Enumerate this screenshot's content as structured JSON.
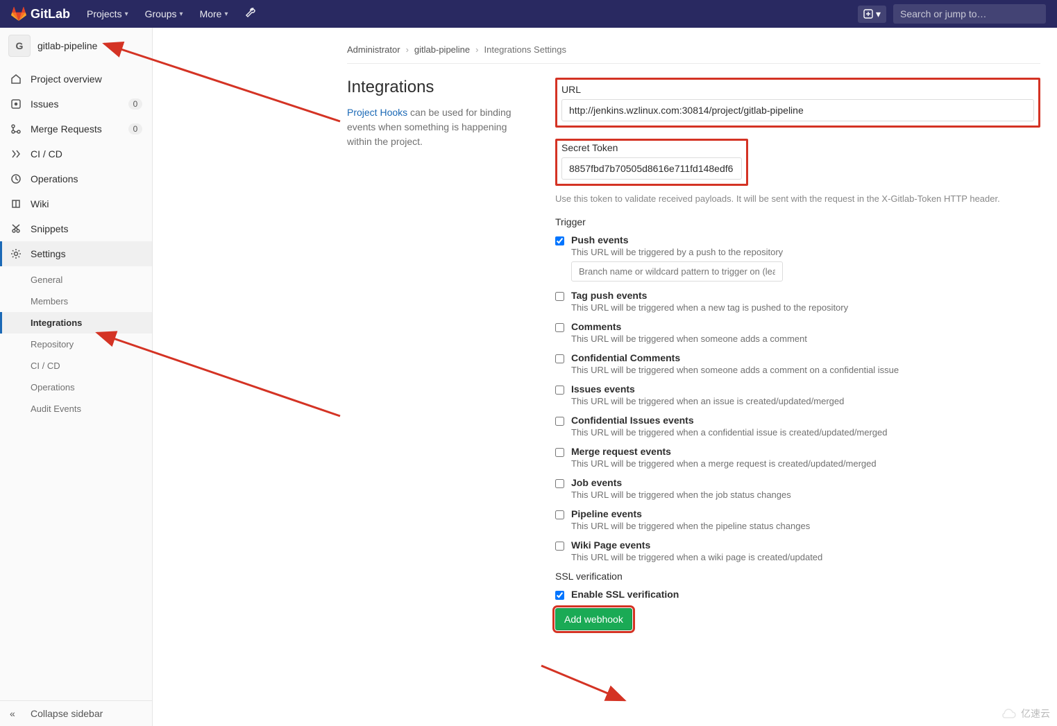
{
  "header": {
    "brand": "GitLab",
    "nav": [
      "Projects",
      "Groups",
      "More"
    ],
    "search_placeholder": "Search or jump to…"
  },
  "sidebar": {
    "avatar_letter": "G",
    "project_name": "gitlab-pipeline",
    "items": [
      {
        "icon": "home-icon",
        "label": "Project overview",
        "badge": ""
      },
      {
        "icon": "issues-icon",
        "label": "Issues",
        "badge": "0"
      },
      {
        "icon": "merge-icon",
        "label": "Merge Requests",
        "badge": "0"
      },
      {
        "icon": "cicd-icon",
        "label": "CI / CD",
        "badge": ""
      },
      {
        "icon": "ops-icon",
        "label": "Operations",
        "badge": ""
      },
      {
        "icon": "wiki-icon",
        "label": "Wiki",
        "badge": ""
      },
      {
        "icon": "snip-icon",
        "label": "Snippets",
        "badge": ""
      },
      {
        "icon": "gear-icon",
        "label": "Settings",
        "badge": "",
        "active": true
      }
    ],
    "settings_submenu": [
      "General",
      "Members",
      "Integrations",
      "Repository",
      "CI / CD",
      "Operations",
      "Audit Events"
    ],
    "settings_active_index": 2,
    "collapse_label": "Collapse sidebar"
  },
  "breadcrumb": {
    "a": "Administrator",
    "b": "gitlab-pipeline",
    "c": "Integrations Settings"
  },
  "page": {
    "title": "Integrations",
    "hooks_link": "Project Hooks",
    "desc_tail": " can be used for binding events when something is happening within the project."
  },
  "form": {
    "url_label": "URL",
    "url_value": "http://jenkins.wzlinux.com:30814/project/gitlab-pipeline",
    "token_label": "Secret Token",
    "token_value": "8857fbd7b70505d8616e711fd148edf6",
    "token_help": "Use this token to validate received payloads. It will be sent with the request in the X-Gitlab-Token HTTP header.",
    "trigger_label": "Trigger",
    "branch_filter_placeholder": "Branch name or wildcard pattern to trigger on (leave blank for all)",
    "triggers": [
      {
        "title": "Push events",
        "desc": "This URL will be triggered by a push to the repository",
        "checked": true,
        "has_filter": true
      },
      {
        "title": "Tag push events",
        "desc": "This URL will be triggered when a new tag is pushed to the repository",
        "checked": false
      },
      {
        "title": "Comments",
        "desc": "This URL will be triggered when someone adds a comment",
        "checked": false
      },
      {
        "title": "Confidential Comments",
        "desc": "This URL will be triggered when someone adds a comment on a confidential issue",
        "checked": false
      },
      {
        "title": "Issues events",
        "desc": "This URL will be triggered when an issue is created/updated/merged",
        "checked": false
      },
      {
        "title": "Confidential Issues events",
        "desc": "This URL will be triggered when a confidential issue is created/updated/merged",
        "checked": false
      },
      {
        "title": "Merge request events",
        "desc": "This URL will be triggered when a merge request is created/updated/merged",
        "checked": false
      },
      {
        "title": "Job events",
        "desc": "This URL will be triggered when the job status changes",
        "checked": false
      },
      {
        "title": "Pipeline events",
        "desc": "This URL will be triggered when the pipeline status changes",
        "checked": false
      },
      {
        "title": "Wiki Page events",
        "desc": "This URL will be triggered when a wiki page is created/updated",
        "checked": false
      }
    ],
    "ssl_section": "SSL verification",
    "ssl_enable": "Enable SSL verification",
    "ssl_checked": true,
    "submit_label": "Add webhook"
  },
  "watermark": "亿速云"
}
